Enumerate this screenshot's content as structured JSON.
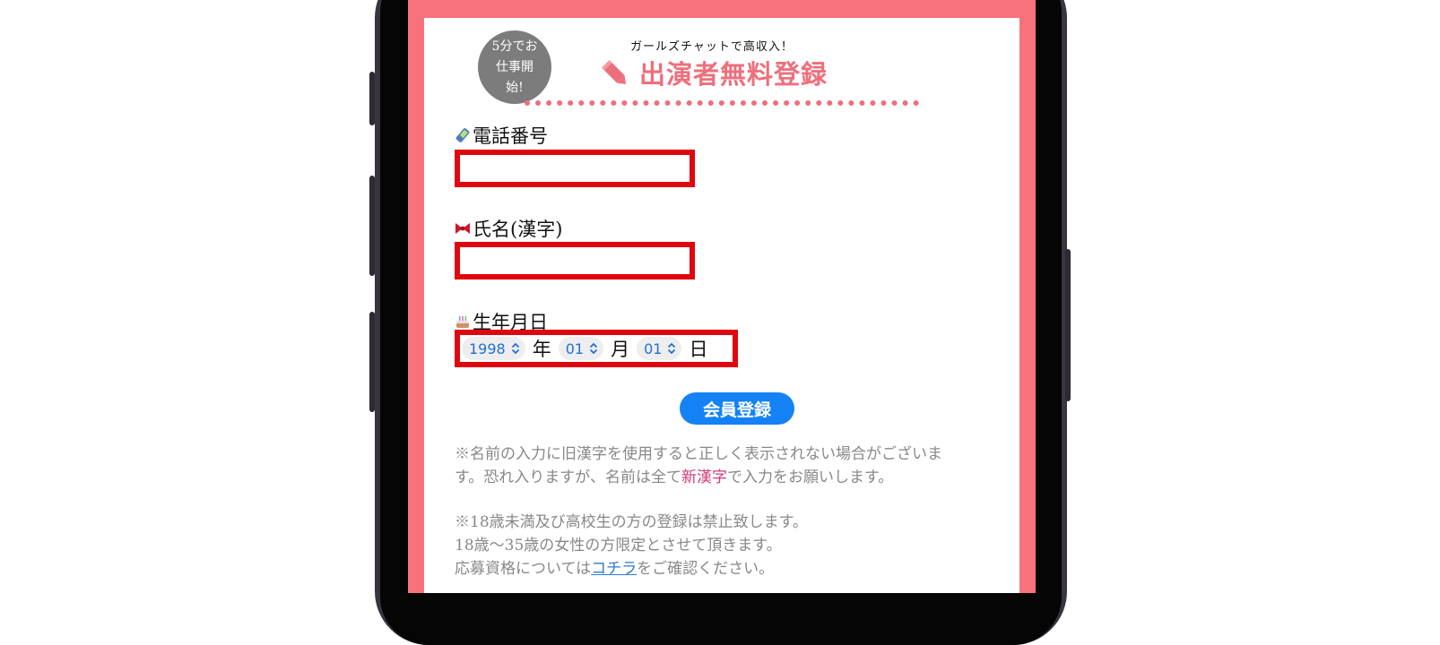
{
  "header": {
    "badge_text": "5分でお仕事開始!",
    "tagline": "ガールズチャットで高収入！",
    "title": "出演者無料登録"
  },
  "form": {
    "phone_label": "電話番号",
    "phone_value": "",
    "name_label": "氏名(漢字)",
    "name_value": "",
    "birth_label": "生年月日",
    "year_value": "1998",
    "year_unit": "年",
    "month_value": "01",
    "month_unit": "月",
    "day_value": "01",
    "day_unit": "日",
    "submit_label": "会員登録"
  },
  "notes": {
    "kanji_line1": "※名前の入力に旧漢字を使用すると正しく表示されない場合がございま",
    "kanji_line2_pre": "す。恐れ入りますが、名前は全て",
    "kanji_highlight": "新漢字",
    "kanji_line2_post": "で入力をお願いします。",
    "age_line1": "※18歳未満及び高校生の方の登録は禁止致します。",
    "age_line2": "18歳〜35歳の女性の方限定とさせて頂きます。",
    "age_line3_pre": "応募資格については",
    "age_link": "コチラ",
    "age_line3_post": "をご確認ください。"
  },
  "icons": {
    "pencil": "pencil-icon",
    "phone": "mobile-phone-icon",
    "name": "ribbon-icon",
    "birthday": "birthday-cake-icon",
    "select_arrow": "chevron-updown-icon"
  },
  "colors": {
    "frame": "#f7727a",
    "title": "#ee6f7c",
    "input_border": "#e0060f",
    "button": "#1482f5",
    "select_text": "#1e6fd9",
    "highlight": "#d03a7c",
    "link": "#2f7ad0"
  }
}
